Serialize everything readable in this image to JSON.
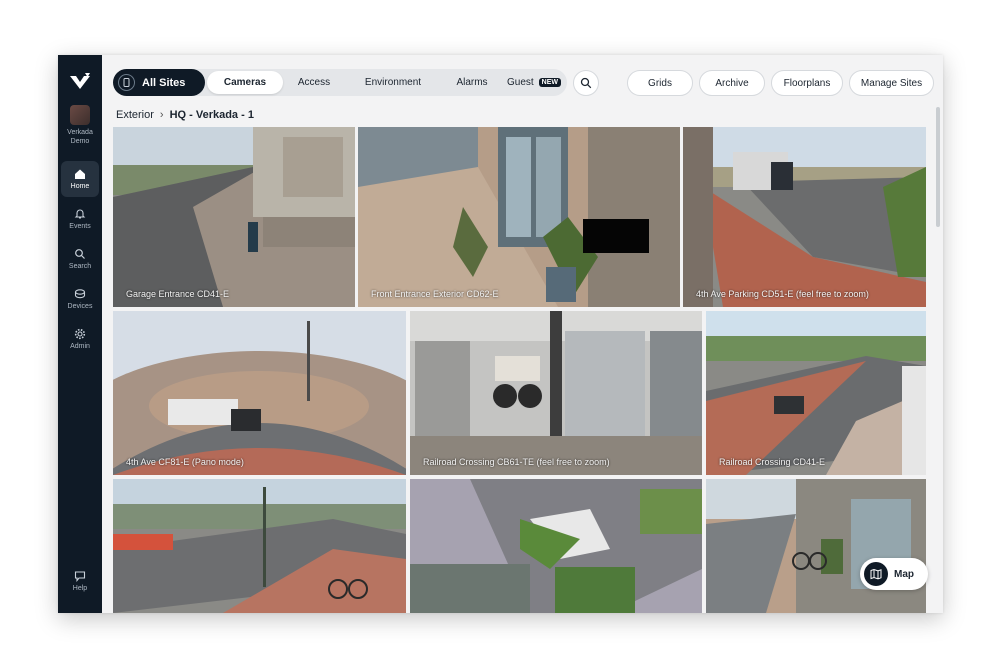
{
  "sidebar": {
    "org_name": "Verkada Demo",
    "items": [
      {
        "label": "Home",
        "icon": "home-icon"
      },
      {
        "label": "Events",
        "icon": "bell-icon"
      },
      {
        "label": "Search",
        "icon": "search-icon"
      },
      {
        "label": "Devices",
        "icon": "devices-icon"
      },
      {
        "label": "Admin",
        "icon": "gear-icon"
      },
      {
        "label": "Help",
        "icon": "chat-icon"
      }
    ]
  },
  "topbar": {
    "all_sites": "All Sites",
    "tabs": [
      {
        "label": "Cameras"
      },
      {
        "label": "Access"
      },
      {
        "label": "Environment"
      },
      {
        "label": "Alarms"
      },
      {
        "label": "Guest",
        "badge": "NEW"
      }
    ],
    "actions": [
      "Grids",
      "Archive",
      "Floorplans",
      "Manage Sites"
    ]
  },
  "breadcrumb": {
    "parent": "Exterior",
    "current": "HQ - Verkada - 1"
  },
  "cameras": [
    {
      "label": "Garage Entrance CD41-E"
    },
    {
      "label": "Front Entrance Exterior CD62-E"
    },
    {
      "label": "4th Ave Parking CD51-E (feel free to zoom)"
    },
    {
      "label": "4th Ave CF81-E (Pano mode)"
    },
    {
      "label": "Railroad Crossing CB61-TE (feel free to zoom)"
    },
    {
      "label": "Railroad Crossing CD41-E"
    },
    {
      "label": ""
    },
    {
      "label": ""
    },
    {
      "label": ""
    }
  ],
  "map_button": "Map",
  "colors": {
    "sidebar_bg": "#0f1a26",
    "accent": "#0f1a26",
    "surface": "#f3f3f4"
  }
}
